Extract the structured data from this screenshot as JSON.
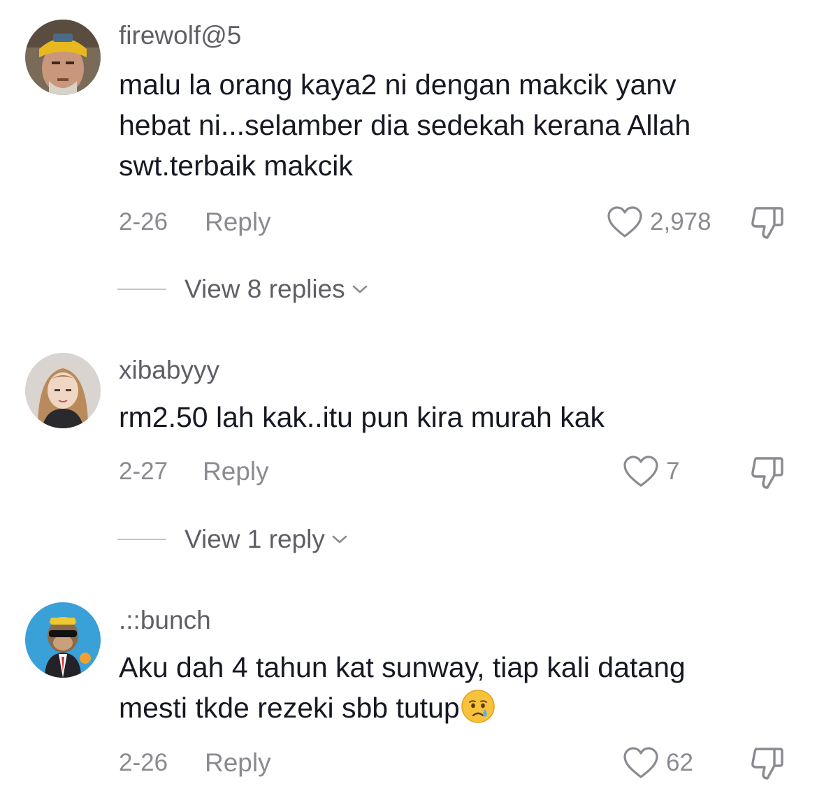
{
  "comments": [
    {
      "username": "firewolf@5",
      "text": "malu la orang kaya2 ni dengan makcik yanv\nhebat ni...selamber dia sedekah kerana Allah\nswt.terbaik makcik",
      "date": "2-26",
      "reply_label": "Reply",
      "likes": "2,978",
      "view_replies": "View 8 replies",
      "avatar_icon": "man-yellow-bandana-avatar"
    },
    {
      "username": "xibabyyy",
      "text": "rm2.50 lah kak..itu pun kira murah kak",
      "date": "2-27",
      "reply_label": "Reply",
      "likes": "7",
      "view_replies": "View 1 reply",
      "avatar_icon": "girl-selfie-avatar"
    },
    {
      "username": ".::bunch",
      "text": "Aku dah 4 tahun kat sunway, tiap kali datang\nmesti tkde rezeki sbb tutup",
      "emoji": "crying-face-emoji",
      "date": "2-26",
      "reply_label": "Reply",
      "likes": "62",
      "avatar_icon": "cartoon-ape-suit-avatar"
    }
  ],
  "colors": {
    "primary_text": "#161823",
    "secondary_text": "#8a8b91",
    "username": "#5e5f66"
  }
}
